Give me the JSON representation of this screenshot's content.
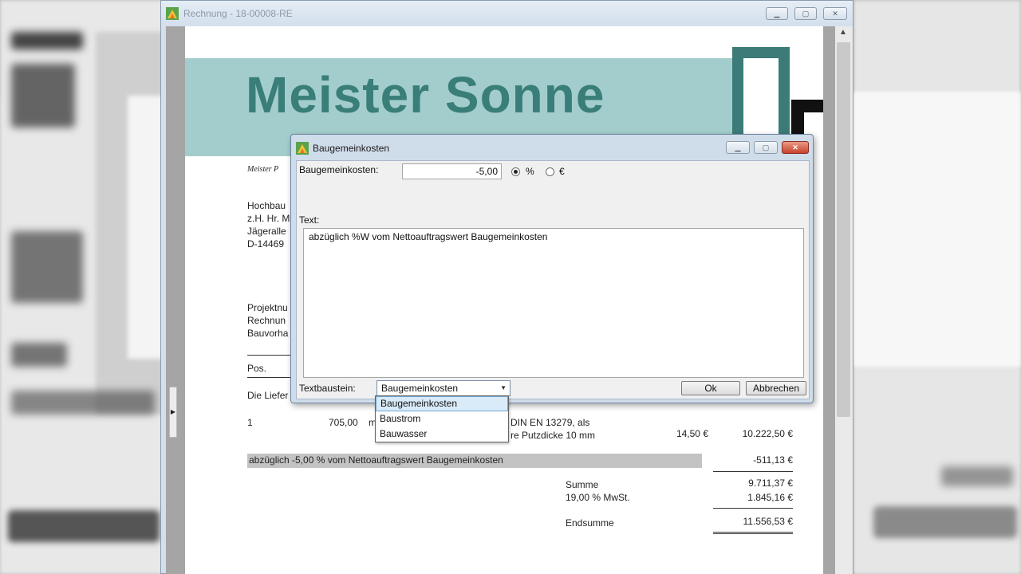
{
  "main_window": {
    "title": "Rechnung - 18-00008-RE"
  },
  "document": {
    "banner_title": "Meister Sonne",
    "sender_line": "Meister P",
    "address": [
      "Hochbau",
      "z.H. Hr. M",
      "Jägeralle",
      "D-14469"
    ],
    "project_lines": [
      "Projektnu",
      "Rechnun",
      "Bauvorha"
    ],
    "pos_header": "Pos.",
    "delivery_text": "Die Liefer",
    "item": {
      "pos": "1",
      "quantity": "705,00",
      "unit": "m",
      "desc_line1": "DIN EN 13279, als",
      "desc_line2": "re Putzdicke 10 mm",
      "unit_price": "14,50 €",
      "total": "10.222,50 €"
    },
    "deduction_text": "abzüglich -5,00 % vom Nettoauftragswert Baugemeinkosten",
    "deduction_amount": "-511,13 €",
    "sum_label": "Summe",
    "sum_value": "9.711,37 €",
    "vat_label": "19,00 % MwSt.",
    "vat_value": "1.845,16 €",
    "total_label": "Endsumme",
    "total_value": "11.556,53 €"
  },
  "dialog": {
    "title": "Baugemeinkosten",
    "amount_label": "Baugemeinkosten:",
    "amount_value": "-5,00",
    "unit_options": [
      "%",
      "€"
    ],
    "selected_unit": "%",
    "text_label": "Text:",
    "text_value": "abzüglich %W vom Nettoauftragswert Baugemeinkosten",
    "textbaustein_label": "Textbaustein:",
    "textbaustein_selected": "Baugemeinkosten",
    "textbaustein_options": [
      "Baugemeinkosten",
      "Baustrom",
      "Bauwasser"
    ],
    "ok_label": "Ok",
    "cancel_label": "Abbrechen"
  },
  "colors": {
    "banner": "#a3cdcc",
    "brand_text": "#3a7e79",
    "logo": "#3c7b77"
  }
}
